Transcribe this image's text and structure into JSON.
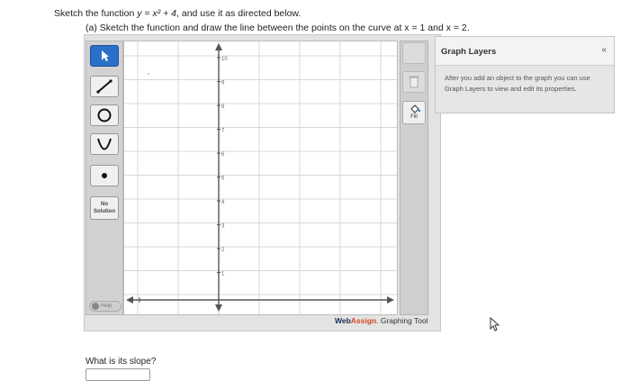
{
  "question": {
    "intro_prefix": "Sketch the function ",
    "function_text": "y = x² + 4",
    "intro_suffix": ", and use it as directed below.",
    "part_a": "(a) Sketch the function and draw the line between the points on the curve at x = 1 and x = 2."
  },
  "toolbar": {
    "tools": [
      {
        "name": "pointer",
        "icon": "arrow-cursor-icon",
        "active": true
      },
      {
        "name": "line",
        "icon": "line-tool-icon",
        "active": false
      },
      {
        "name": "circle",
        "icon": "circle-tool-icon",
        "active": false
      },
      {
        "name": "parabola",
        "icon": "parabola-tool-icon",
        "active": false
      },
      {
        "name": "point",
        "icon": "point-tool-icon",
        "active": false
      }
    ],
    "no_solution_line1": "No",
    "no_solution_line2": "Solution",
    "help_label": "Help"
  },
  "graph": {
    "y_ticks": [
      "10",
      "9",
      "8",
      "7",
      "6",
      "5",
      "4",
      "3",
      "2",
      "1"
    ]
  },
  "right_toolbar": {
    "fill_label": "Fill"
  },
  "branding": {
    "web": "Web",
    "assign": "Assign",
    "suffix": ". Graphing Tool"
  },
  "layers_panel": {
    "title": "Graph Layers",
    "collapse_symbol": "«",
    "description": "After you add an object to the graph you can use Graph Layers to view and edit its properties."
  },
  "slope_question": "What is its slope?",
  "colors": {
    "active_tool": "#2a70c8",
    "brand_web": "#1a2b55",
    "brand_assign": "#d04a1e"
  }
}
